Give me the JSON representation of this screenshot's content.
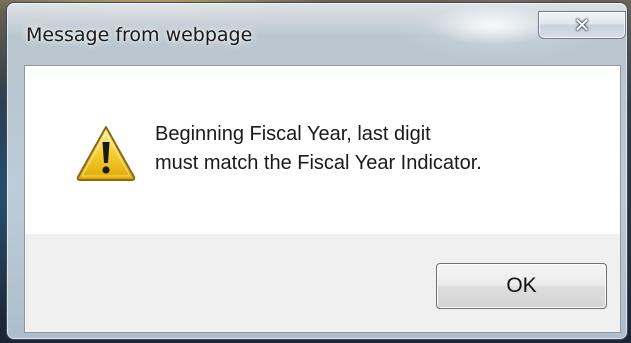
{
  "dialog": {
    "title": "Message from webpage",
    "close_glyph": "✕",
    "icon": "warning-icon",
    "message_line1": "Beginning Fiscal Year, last digit",
    "message_line2": "must match the Fiscal Year Indicator.",
    "ok_label": "OK"
  },
  "colors": {
    "warning_fill": "#f5c518",
    "warning_outline": "#7a5a00",
    "content_bg": "#ffffff",
    "button_row_bg": "#f0f0f0"
  }
}
